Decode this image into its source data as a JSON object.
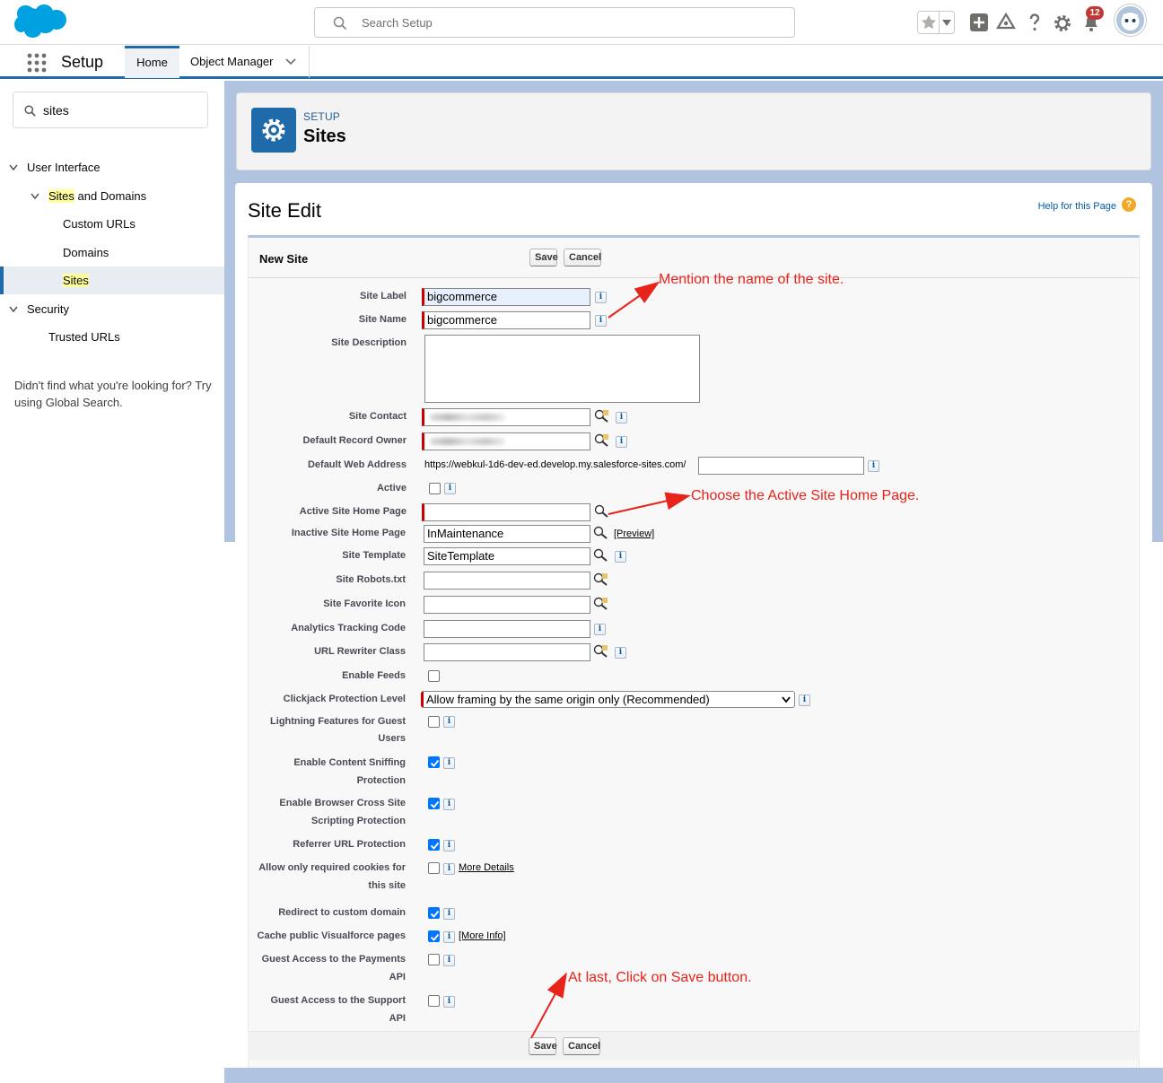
{
  "header": {
    "search_placeholder": "Search Setup",
    "notification_count": "12"
  },
  "nav": {
    "app_name": "Setup",
    "tabs": [
      {
        "label": "Home"
      },
      {
        "label": "Object Manager"
      }
    ]
  },
  "sidebar": {
    "quick_find_value": "sites",
    "tree": {
      "user_interface": "User Interface",
      "sites_and_domains_hl": "Sites",
      "sites_and_domains_rest": " and Domains",
      "custom_urls": "Custom URLs",
      "domains": "Domains",
      "sites": "Sites",
      "security": "Security",
      "trusted_urls": "Trusted URLs"
    },
    "not_found_text": "Didn't find what you're looking for? Try using Global Search."
  },
  "page_header": {
    "kicker": "SETUP",
    "title": "Sites"
  },
  "main": {
    "section_title": "Site Edit",
    "help_link": "Help for this Page",
    "help_icon": "?",
    "block_title": "New Site",
    "save_label": "Save",
    "cancel_label": "Cancel",
    "info_glyph": "i"
  },
  "form": {
    "site_label": {
      "label": "Site Label",
      "value": "bigcommerce"
    },
    "site_name": {
      "label": "Site Name",
      "value": "bigcommerce"
    },
    "site_description": {
      "label": "Site Description",
      "value": ""
    },
    "site_contact": {
      "label": "Site Contact"
    },
    "default_record_owner": {
      "label": "Default Record Owner"
    },
    "default_web_address": {
      "label": "Default Web Address",
      "prefix": "https://webkul-1d6-dev-ed.develop.my.salesforce-sites.com/",
      "value": ""
    },
    "active": {
      "label": "Active",
      "checked": false
    },
    "active_home": {
      "label": "Active Site Home Page",
      "value": ""
    },
    "inactive_home": {
      "label": "Inactive Site Home Page",
      "value": "InMaintenance",
      "preview": "[Preview]"
    },
    "site_template": {
      "label": "Site Template",
      "value": "SiteTemplate"
    },
    "robots": {
      "label": "Site Robots.txt",
      "value": ""
    },
    "favicon": {
      "label": "Site Favorite Icon",
      "value": ""
    },
    "analytics": {
      "label": "Analytics Tracking Code",
      "value": ""
    },
    "url_rewriter": {
      "label": "URL Rewriter Class",
      "value": ""
    },
    "enable_feeds": {
      "label": "Enable Feeds",
      "checked": false
    },
    "clickjack": {
      "label": "Clickjack Protection Level",
      "value": "Allow framing by the same origin only (Recommended)"
    },
    "lightning_guest": {
      "label_1": "Lightning Features for Guest",
      "label_2": "Users",
      "checked": false
    },
    "content_sniffing": {
      "label_1": "Enable Content Sniffing",
      "label_2": "Protection",
      "checked": true
    },
    "xss": {
      "label_1": "Enable Browser Cross Site",
      "label_2": "Scripting Protection",
      "checked": true
    },
    "referrer": {
      "label": "Referrer URL Protection",
      "checked": true
    },
    "cookies": {
      "label_1": "Allow only required cookies for",
      "label_2": "this site",
      "checked": false,
      "link": "More Details"
    },
    "redirect": {
      "label": "Redirect to custom domain",
      "checked": true
    },
    "cache_vf": {
      "label": "Cache public Visualforce pages",
      "checked": true,
      "link": "[More Info]"
    },
    "guest_payments": {
      "label_1": "Guest Access to the Payments",
      "label_2": "API",
      "checked": false
    },
    "guest_support": {
      "label": "Guest Access to the Support API",
      "checked": false
    }
  },
  "annotations": {
    "name_note": "Mention the name of the site.",
    "home_note": "Choose the Active Site Home Page.",
    "save_note": "At last, Click on Save button.",
    "color": "#e8231c"
  },
  "colors": {
    "brand": "#1f6aa8",
    "required": "#cc0000",
    "highlight": "#ffff9e"
  }
}
